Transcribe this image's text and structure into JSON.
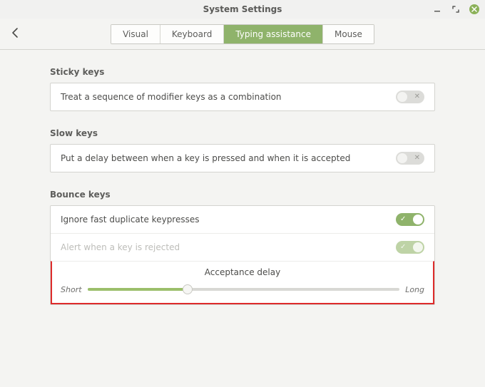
{
  "window": {
    "title": "System Settings"
  },
  "tabs": {
    "visual": "Visual",
    "keyboard": "Keyboard",
    "typing_assistance": "Typing assistance",
    "mouse": "Mouse",
    "active": "typing_assistance"
  },
  "sections": {
    "sticky": {
      "title": "Sticky keys",
      "row0": {
        "label": "Treat a sequence of modifier keys as a combination",
        "on": false
      }
    },
    "slow": {
      "title": "Slow keys",
      "row0": {
        "label": "Put a delay between when a key is pressed and when it is accepted",
        "on": false
      }
    },
    "bounce": {
      "title": "Bounce keys",
      "row0": {
        "label": "Ignore fast duplicate keypresses",
        "on": true
      },
      "row1": {
        "label": "Alert when a key is rejected",
        "on": true,
        "dim": true
      },
      "slider": {
        "title": "Acceptance delay",
        "min_label": "Short",
        "max_label": "Long",
        "value_pct": 32
      }
    }
  }
}
